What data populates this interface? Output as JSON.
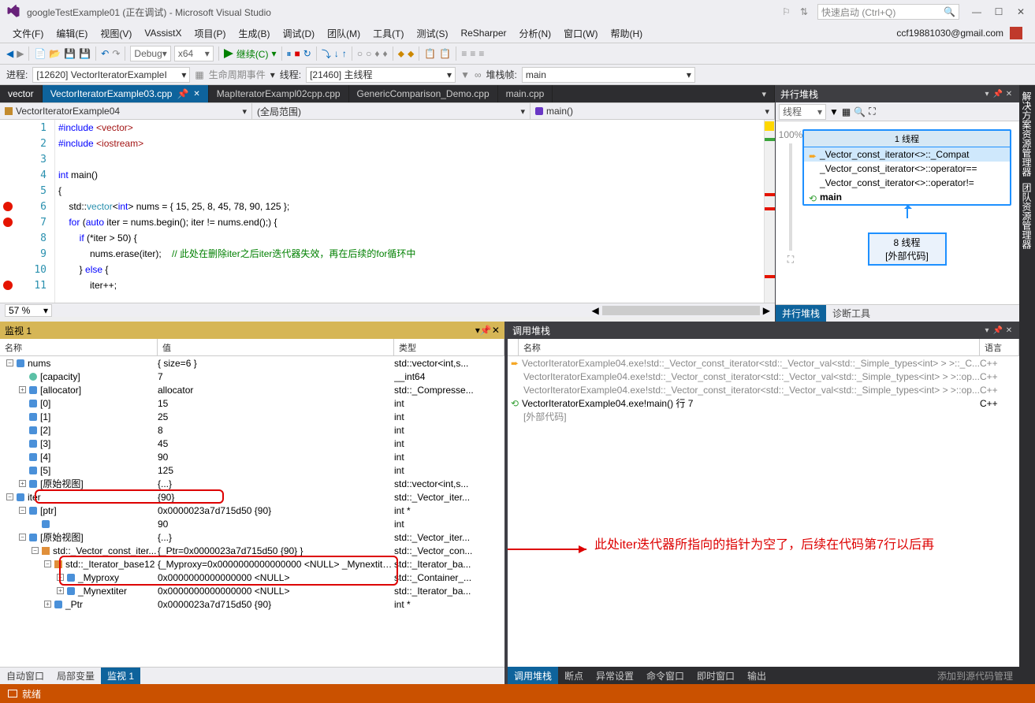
{
  "title": "googleTestExample01 (正在调试) - Microsoft Visual Studio",
  "quickLaunch": "快速启动 (Ctrl+Q)",
  "userEmail": "ccf19881030@gmail.com",
  "menus": [
    "文件(F)",
    "编辑(E)",
    "视图(V)",
    "VAssistX",
    "项目(P)",
    "生成(B)",
    "调试(D)",
    "团队(M)",
    "工具(T)",
    "测试(S)",
    "ReSharper",
    "分析(N)",
    "窗口(W)",
    "帮助(H)"
  ],
  "toolbar": {
    "config": "Debug",
    "platform": "x64",
    "play": "继续(C)"
  },
  "toolbar2": {
    "process_label": "进程:",
    "process": "[12620] VectorIteratorExampleI",
    "lifecycle": "生命周期事件",
    "thread_label": "线程:",
    "thread": "[21460] 主线程",
    "stackframe_label": "堆栈帧:",
    "stackframe": "main"
  },
  "docTabs": {
    "first": "vector",
    "active": "VectorIteratorExample03.cpp",
    "t3": "MapIteratorExampl02cpp.cpp",
    "t4": "GenericComparison_Demo.cpp",
    "t5": "main.cpp"
  },
  "navBar": {
    "scope": "VectorIteratorExample04",
    "region": "(全局范围)",
    "func": "main()"
  },
  "code": {
    "l1a": "#include ",
    "l1b": "<vector>",
    "l2a": "#include ",
    "l2b": "<iostream>",
    "l4a": "int",
    "l4b": " main()",
    "l5": "{",
    "l6a": "    std::",
    "l6b": "vector",
    "l6c": "<",
    "l6d": "int",
    "l6e": "> nums = { 15, 25, 8, 45, 78, 90, 125 };",
    "l7a": "    ",
    "l7b": "for",
    "l7c": " (",
    "l7d": "auto",
    "l7e": " iter = nums.begin(); iter != nums.end();) {",
    "l8a": "        ",
    "l8b": "if",
    "l8c": " (*iter > 50) {",
    "l9a": "            nums.erase(iter);    ",
    "l9b": "// 此处在删除iter之后iter迭代器失效，再在后续的for循环中",
    "l10a": "        } ",
    "l10b": "else",
    "l10c": " {",
    "l11": "            iter++;"
  },
  "zoom": "57 %",
  "parallel": {
    "title": "并行堆栈",
    "filter": "线程",
    "box_title": "1 线程",
    "items": [
      "_Vector_const_iterator<>::_Compat",
      "_Vector_const_iterator<>::operator==",
      "_Vector_const_iterator<>::operator!=",
      "main"
    ],
    "ext_title": "8 线程",
    "ext_body": "[外部代码]",
    "tabs": [
      "并行堆栈",
      "诊断工具"
    ]
  },
  "watch": {
    "title": "监视 1",
    "cols": {
      "name": "名称",
      "val": "值",
      "type": "类型"
    },
    "rows": [
      {
        "indent": 0,
        "tog": "-",
        "icon": "blue",
        "name": "nums",
        "val": "{ size=6 }",
        "type": "std::vector<int,s..."
      },
      {
        "indent": 1,
        "tog": "",
        "icon": "teal",
        "name": "[capacity]",
        "val": "7",
        "type": "__int64"
      },
      {
        "indent": 1,
        "tog": "+",
        "icon": "blue",
        "name": "[allocator]",
        "val": "allocator",
        "type": "std::_Compresse..."
      },
      {
        "indent": 1,
        "tog": "",
        "icon": "blue",
        "name": "[0]",
        "val": "15",
        "type": "int"
      },
      {
        "indent": 1,
        "tog": "",
        "icon": "blue",
        "name": "[1]",
        "val": "25",
        "type": "int"
      },
      {
        "indent": 1,
        "tog": "",
        "icon": "blue",
        "name": "[2]",
        "val": "8",
        "type": "int"
      },
      {
        "indent": 1,
        "tog": "",
        "icon": "blue",
        "name": "[3]",
        "val": "45",
        "type": "int"
      },
      {
        "indent": 1,
        "tog": "",
        "icon": "blue",
        "name": "[4]",
        "val": "90",
        "type": "int"
      },
      {
        "indent": 1,
        "tog": "",
        "icon": "blue",
        "name": "[5]",
        "val": "125",
        "type": "int"
      },
      {
        "indent": 1,
        "tog": "+",
        "icon": "blue",
        "name": "[原始视图]",
        "val": "{...}",
        "type": "std::vector<int,s..."
      },
      {
        "indent": 0,
        "tog": "-",
        "icon": "blue",
        "name": "iter",
        "val": "{90}",
        "type": "std::_Vector_iter..."
      },
      {
        "indent": 1,
        "tog": "-",
        "icon": "blue",
        "name": "[ptr]",
        "val": "0x0000023a7d715d50 {90}",
        "type": "int *"
      },
      {
        "indent": 2,
        "tog": "",
        "icon": "blue",
        "name": "",
        "val": "90",
        "type": "int"
      },
      {
        "indent": 1,
        "tog": "-",
        "icon": "blue",
        "name": "[原始视图]",
        "val": "{...}",
        "type": "std::_Vector_iter..."
      },
      {
        "indent": 2,
        "tog": "-",
        "icon": "orange",
        "name": "std::_Vector_const_iter...",
        "val": "{_Ptr=0x0000023a7d715d50 {90} }",
        "type": "std::_Vector_con..."
      },
      {
        "indent": 3,
        "tog": "-",
        "icon": "orange",
        "name": "std::_Iterator_base12",
        "val": "{_Myproxy=0x0000000000000000 <NULL> _Mynextiter...",
        "type": "std::_Iterator_ba..."
      },
      {
        "indent": 4,
        "tog": "+",
        "icon": "blue",
        "name": "_Myproxy",
        "val": "0x0000000000000000 <NULL>",
        "type": "std::_Container_..."
      },
      {
        "indent": 4,
        "tog": "+",
        "icon": "blue",
        "name": "_Mynextiter",
        "val": "0x0000000000000000 <NULL>",
        "type": "std::_Iterator_ba..."
      },
      {
        "indent": 3,
        "tog": "+",
        "icon": "blue",
        "name": "_Ptr",
        "val": "0x0000023a7d715d50 {90}",
        "type": "int *"
      }
    ],
    "tabs": [
      "自动窗口",
      "局部变量",
      "监视 1"
    ]
  },
  "callstack": {
    "title": "调用堆栈",
    "cols": {
      "name": "名称",
      "lang": "语言"
    },
    "rows": [
      {
        "icon": "yellow",
        "dim": true,
        "name": "VectorIteratorExample04.exe!std::_Vector_const_iterator<std::_Vector_val<std::_Simple_types<int> > >::_C...",
        "lang": "C++"
      },
      {
        "icon": "",
        "dim": true,
        "name": "VectorIteratorExample04.exe!std::_Vector_const_iterator<std::_Vector_val<std::_Simple_types<int> > >::op...",
        "lang": "C++"
      },
      {
        "icon": "",
        "dim": true,
        "name": "VectorIteratorExample04.exe!std::_Vector_const_iterator<std::_Vector_val<std::_Simple_types<int> > >::op...",
        "lang": "C++"
      },
      {
        "icon": "green",
        "dim": false,
        "name": "VectorIteratorExample04.exe!main() 行 7",
        "lang": "C++"
      },
      {
        "icon": "",
        "dim": true,
        "name": "[外部代码]",
        "lang": ""
      }
    ],
    "annotation": "此处iter迭代器所指向的指针为空了，后续在代码第7行以后再",
    "tabs": [
      "调用堆栈",
      "断点",
      "异常设置",
      "命令窗口",
      "即时窗口",
      "输出"
    ],
    "right_text": "添加到源代码管理"
  },
  "sidebar": {
    "t1": "解决方案资源管理器",
    "t2": "团队资源管理器"
  },
  "status": "就绪"
}
